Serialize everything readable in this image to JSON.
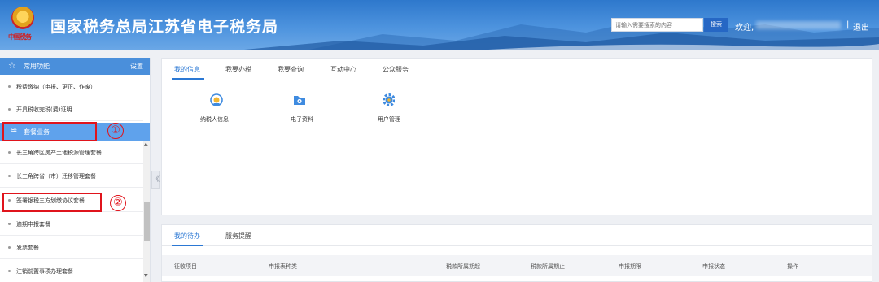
{
  "header": {
    "site_title": "国家税务总局江苏省电子税务局",
    "emblem_caption": "中国税务",
    "search_placeholder": "请输入需要搜索的内容",
    "search_button": "搜索",
    "welcome": "欢迎,",
    "divider": "|",
    "logout": "退出",
    "colors": {
      "bar": "#4a8fdb",
      "search_button": "#2667c4"
    }
  },
  "sidebar": {
    "header_icon": "star-icon",
    "header_title": "常用功能",
    "settings_label": "设置",
    "items_top": [
      {
        "label": "税费缴纳（申报、更正、作废）"
      },
      {
        "label": "开具税收完税(费)证明"
      }
    ],
    "active_item": {
      "icon": "layers-icon",
      "label": "套餐业务"
    },
    "items_bottom": [
      {
        "label": "长三角跨区房产土地税源管理套餐"
      },
      {
        "label": "长三角跨省（市）迁移管理套餐"
      },
      {
        "label": "签署银税三方划缴协议套餐"
      },
      {
        "label": "逾期申报套餐"
      },
      {
        "label": "发票套餐"
      },
      {
        "label": "注销前置事项办理套餐"
      }
    ],
    "collapse_glyph": "《",
    "scroll_up": "▲",
    "scroll_down": "▼"
  },
  "annotations": {
    "one": "①",
    "two": "②",
    "highlight_color": "#e0141c"
  },
  "info_panel": {
    "tabs": [
      "我的信息",
      "我要办税",
      "我要查询",
      "互动中心",
      "公众服务"
    ],
    "active_tab": 0,
    "apps": [
      {
        "label": "纳税人信息",
        "icon": "badge-icon"
      },
      {
        "label": "电子资料",
        "icon": "folder-icon"
      },
      {
        "label": "用户管理",
        "icon": "gear-icon"
      }
    ]
  },
  "todo_panel": {
    "tabs": [
      "我的待办",
      "服务提醒"
    ],
    "active_tab": 0,
    "columns": [
      "征收项目",
      "申报表种类",
      "税款所属期起",
      "税款所属期止",
      "申报期限",
      "申报状态",
      "操作"
    ]
  }
}
